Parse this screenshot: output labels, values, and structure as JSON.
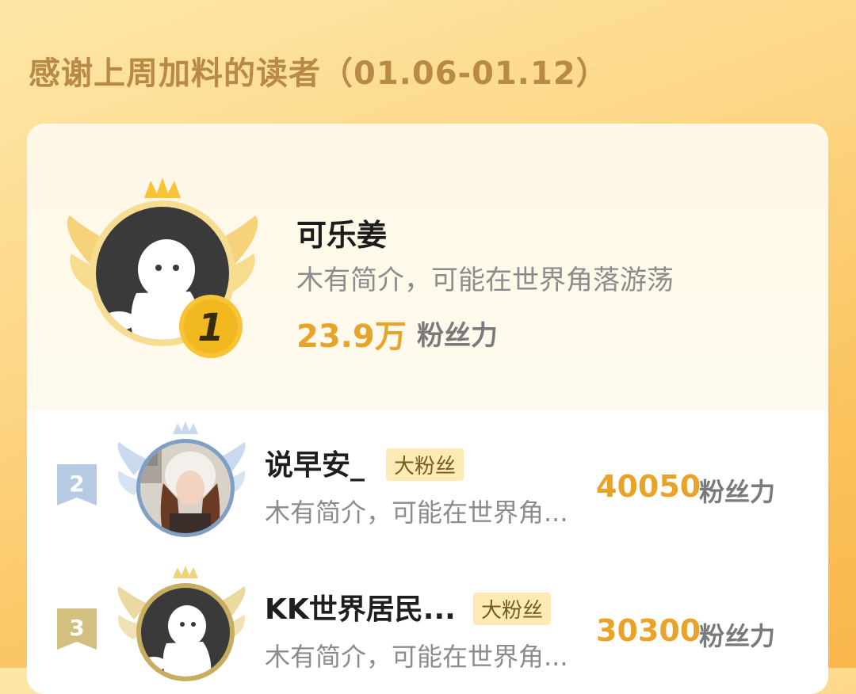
{
  "header": {
    "title": "感谢上周加料的读者（01.06-01.12）"
  },
  "top_reader": {
    "rank": "1",
    "name": "可乐姜",
    "intro": "木有简介，可能在世界角落游荡",
    "score": "23.9万",
    "unit": "粉丝力"
  },
  "readers": [
    {
      "rank": "2",
      "name": "说早安_",
      "tag": "大粉丝",
      "intro": "木有简介，可能在世界角...",
      "score": "40050",
      "unit": "粉丝力"
    },
    {
      "rank": "3",
      "name": "KK世界居民...",
      "tag": "大粉丝",
      "intro": "木有简介，可能在世界角...",
      "score": "30300",
      "unit": "粉丝力"
    }
  ],
  "colors": {
    "accent": "#e8a42a",
    "gold": "#f5c63a",
    "silver": "#a9c4e4",
    "bronze": "#c9b06a"
  },
  "icons": [
    "crown-icon",
    "wings-icon",
    "default-avatar-icon",
    "rank-medal-icon",
    "rank-ribbon-icon"
  ]
}
